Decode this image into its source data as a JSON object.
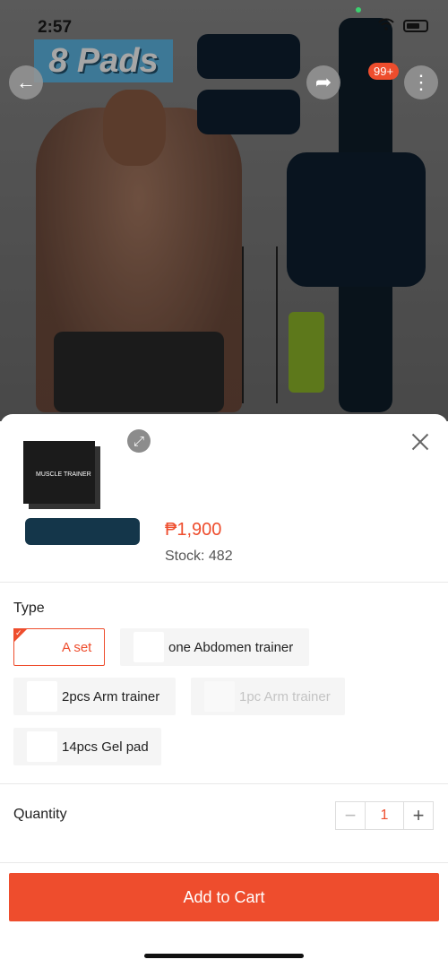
{
  "status": {
    "time": "2:57"
  },
  "hero": {
    "banner_text": "8 Pads",
    "cart_badge": "99+",
    "box_text": "MUSCLE TRAINER"
  },
  "product": {
    "price": "₱1,900",
    "stock": "Stock: 482"
  },
  "variation": {
    "label": "Type",
    "options": [
      {
        "label": "A set",
        "state": "selected"
      },
      {
        "label": "one Abdomen trainer",
        "state": "normal"
      },
      {
        "label": "2pcs Arm trainer",
        "state": "normal"
      },
      {
        "label": "1pc Arm trainer",
        "state": "disabled"
      },
      {
        "label": "14pcs Gel pad",
        "state": "normal"
      }
    ]
  },
  "quantity": {
    "label": "Quantity",
    "value": "1",
    "minus": "−",
    "plus": "+"
  },
  "actions": {
    "add_to_cart": "Add to Cart"
  },
  "colors": {
    "accent": "#ee4d2d"
  }
}
